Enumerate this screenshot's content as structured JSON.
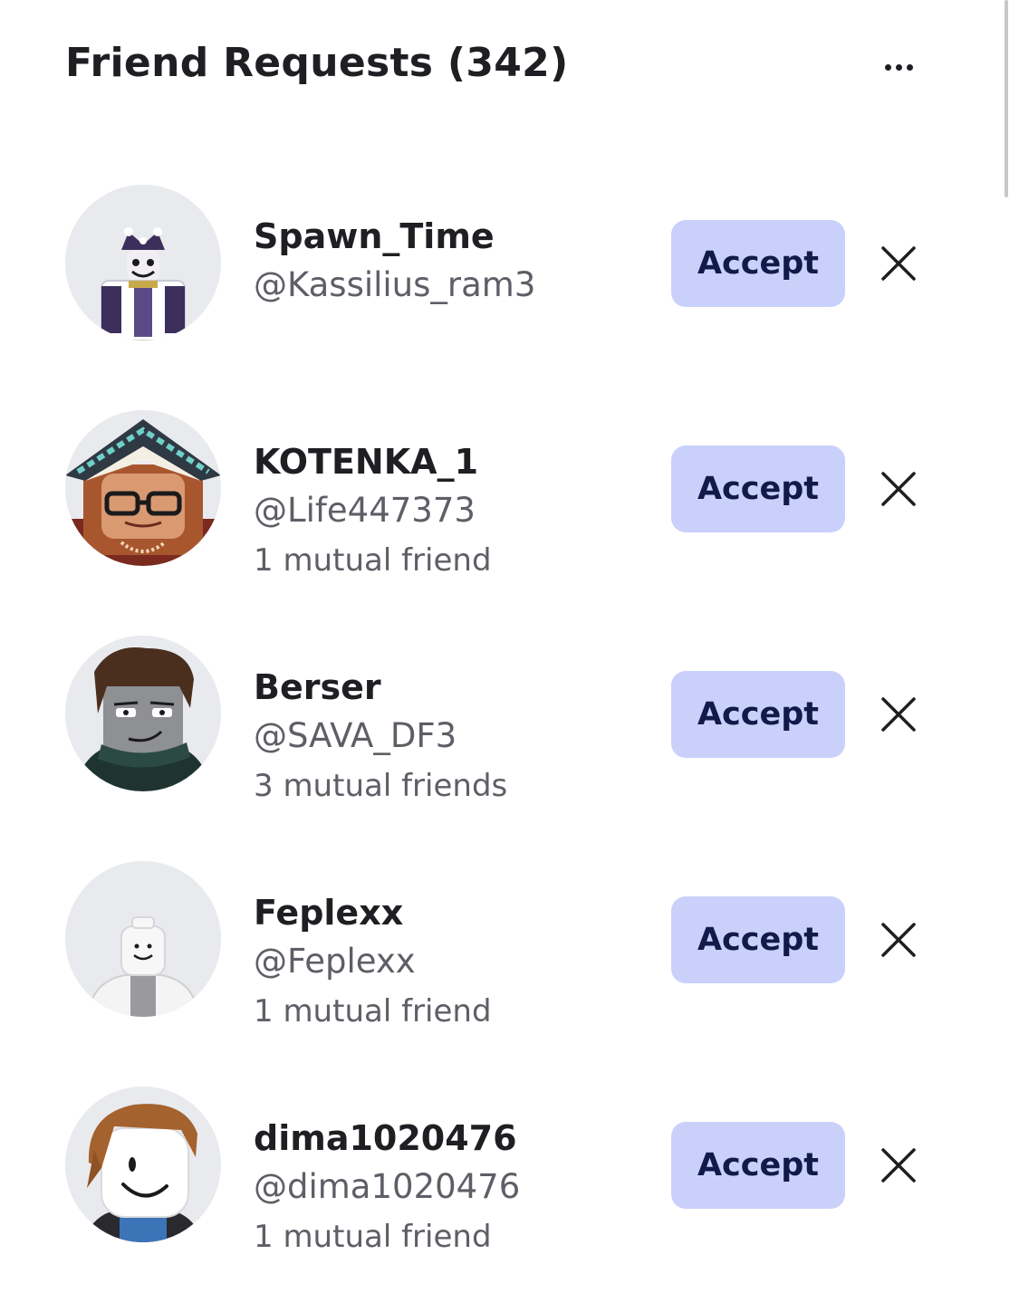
{
  "header": {
    "title": "Friend Requests (342)",
    "more_icon": "more-horizontal-icon"
  },
  "requests": [
    {
      "display_name": "Spawn_Time",
      "username": "@Kassilius_ram3",
      "mutual": "",
      "accept_label": "Accept",
      "decline_icon": "close-icon"
    },
    {
      "display_name": "KOTENKA_1",
      "username": "@Life447373",
      "mutual": "1 mutual friend",
      "accept_label": "Accept",
      "decline_icon": "close-icon"
    },
    {
      "display_name": "Berser",
      "username": "@SAVA_DF3",
      "mutual": "3 mutual friends",
      "accept_label": "Accept",
      "decline_icon": "close-icon"
    },
    {
      "display_name": "Feplexx",
      "username": "@Feplexx",
      "mutual": "1 mutual friend",
      "accept_label": "Accept",
      "decline_icon": "close-icon"
    },
    {
      "display_name": "dima1020476",
      "username": "@dima1020476",
      "mutual": "1 mutual friend",
      "accept_label": "Accept",
      "decline_icon": "close-icon"
    }
  ],
  "colors": {
    "accept_bg": "#c9d1fb",
    "accept_text": "#121a4a",
    "avatar_bg": "#e9eaed",
    "secondary_text": "#5e5f66"
  }
}
